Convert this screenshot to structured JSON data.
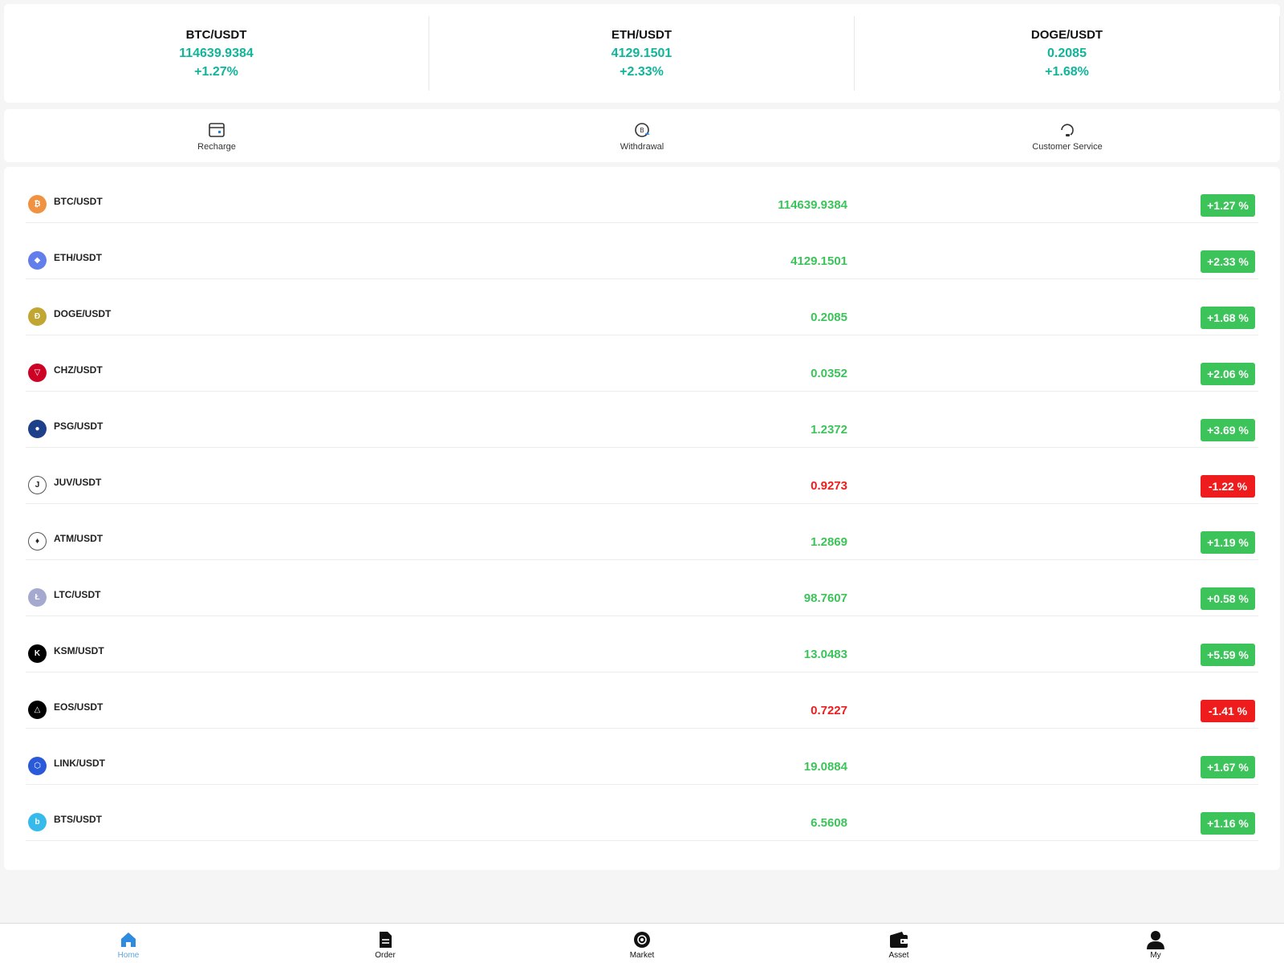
{
  "tickers": [
    {
      "pair": "BTC/USDT",
      "price": "114639.9384",
      "change": "+1.27%"
    },
    {
      "pair": "ETH/USDT",
      "price": "4129.1501",
      "change": "+2.33%"
    },
    {
      "pair": "DOGE/USDT",
      "price": "0.2085",
      "change": "+1.68%"
    }
  ],
  "actions": {
    "recharge": "Recharge",
    "withdrawal": "Withdrawal",
    "customer_service": "Customer Service"
  },
  "market": [
    {
      "pair": "BTC/USDT",
      "price": "114639.9384",
      "change": "+1.27 %",
      "direction": "up",
      "icon": "bitcoin-icon",
      "icon_color": "#f09242"
    },
    {
      "pair": "ETH/USDT",
      "price": "4129.1501",
      "change": "+2.33 %",
      "direction": "up",
      "icon": "ethereum-icon",
      "icon_color": "#627eea"
    },
    {
      "pair": "DOGE/USDT",
      "price": "0.2085",
      "change": "+1.68 %",
      "direction": "up",
      "icon": "dogecoin-icon",
      "icon_color": "#c2a633"
    },
    {
      "pair": "CHZ/USDT",
      "price": "0.0352",
      "change": "+2.06 %",
      "direction": "up",
      "icon": "chiliz-icon",
      "icon_color": "#cd0124"
    },
    {
      "pair": "PSG/USDT",
      "price": "1.2372",
      "change": "+3.69 %",
      "direction": "up",
      "icon": "psg-icon",
      "icon_color": "#1e3f8a"
    },
    {
      "pair": "JUV/USDT",
      "price": "0.9273",
      "change": "-1.22 %",
      "direction": "down",
      "icon": "juventus-icon",
      "icon_color": "#ffffff"
    },
    {
      "pair": "ATM/USDT",
      "price": "1.2869",
      "change": "+1.19 %",
      "direction": "up",
      "icon": "atletico-icon",
      "icon_color": "#ffffff"
    },
    {
      "pair": "LTC/USDT",
      "price": "98.7607",
      "change": "+0.58 %",
      "direction": "up",
      "icon": "litecoin-icon",
      "icon_color": "#a6a9cf"
    },
    {
      "pair": "KSM/USDT",
      "price": "13.0483",
      "change": "+5.59 %",
      "direction": "up",
      "icon": "kusama-icon",
      "icon_color": "#000000"
    },
    {
      "pair": "EOS/USDT",
      "price": "0.7227",
      "change": "-1.41 %",
      "direction": "down",
      "icon": "eos-icon",
      "icon_color": "#000000"
    },
    {
      "pair": "LINK/USDT",
      "price": "19.0884",
      "change": "+1.67 %",
      "direction": "up",
      "icon": "chainlink-icon",
      "icon_color": "#2a5ada"
    },
    {
      "pair": "BTS/USDT",
      "price": "6.5608",
      "change": "+1.16 %",
      "direction": "up",
      "icon": "bitshares-icon",
      "icon_color": "#35baeb"
    }
  ],
  "tabs": [
    {
      "label": "Home",
      "icon": "home-icon",
      "active": true
    },
    {
      "label": "Order",
      "icon": "document-icon",
      "active": false
    },
    {
      "label": "Market",
      "icon": "market-icon",
      "active": false
    },
    {
      "label": "Asset",
      "icon": "wallet-icon",
      "active": false
    },
    {
      "label": "My",
      "icon": "user-icon",
      "active": false
    }
  ],
  "colors": {
    "up": "#3cc35a",
    "down": "#ee1c1c",
    "ticker": "#10b59a",
    "tab_active": "#5aa6e8"
  }
}
